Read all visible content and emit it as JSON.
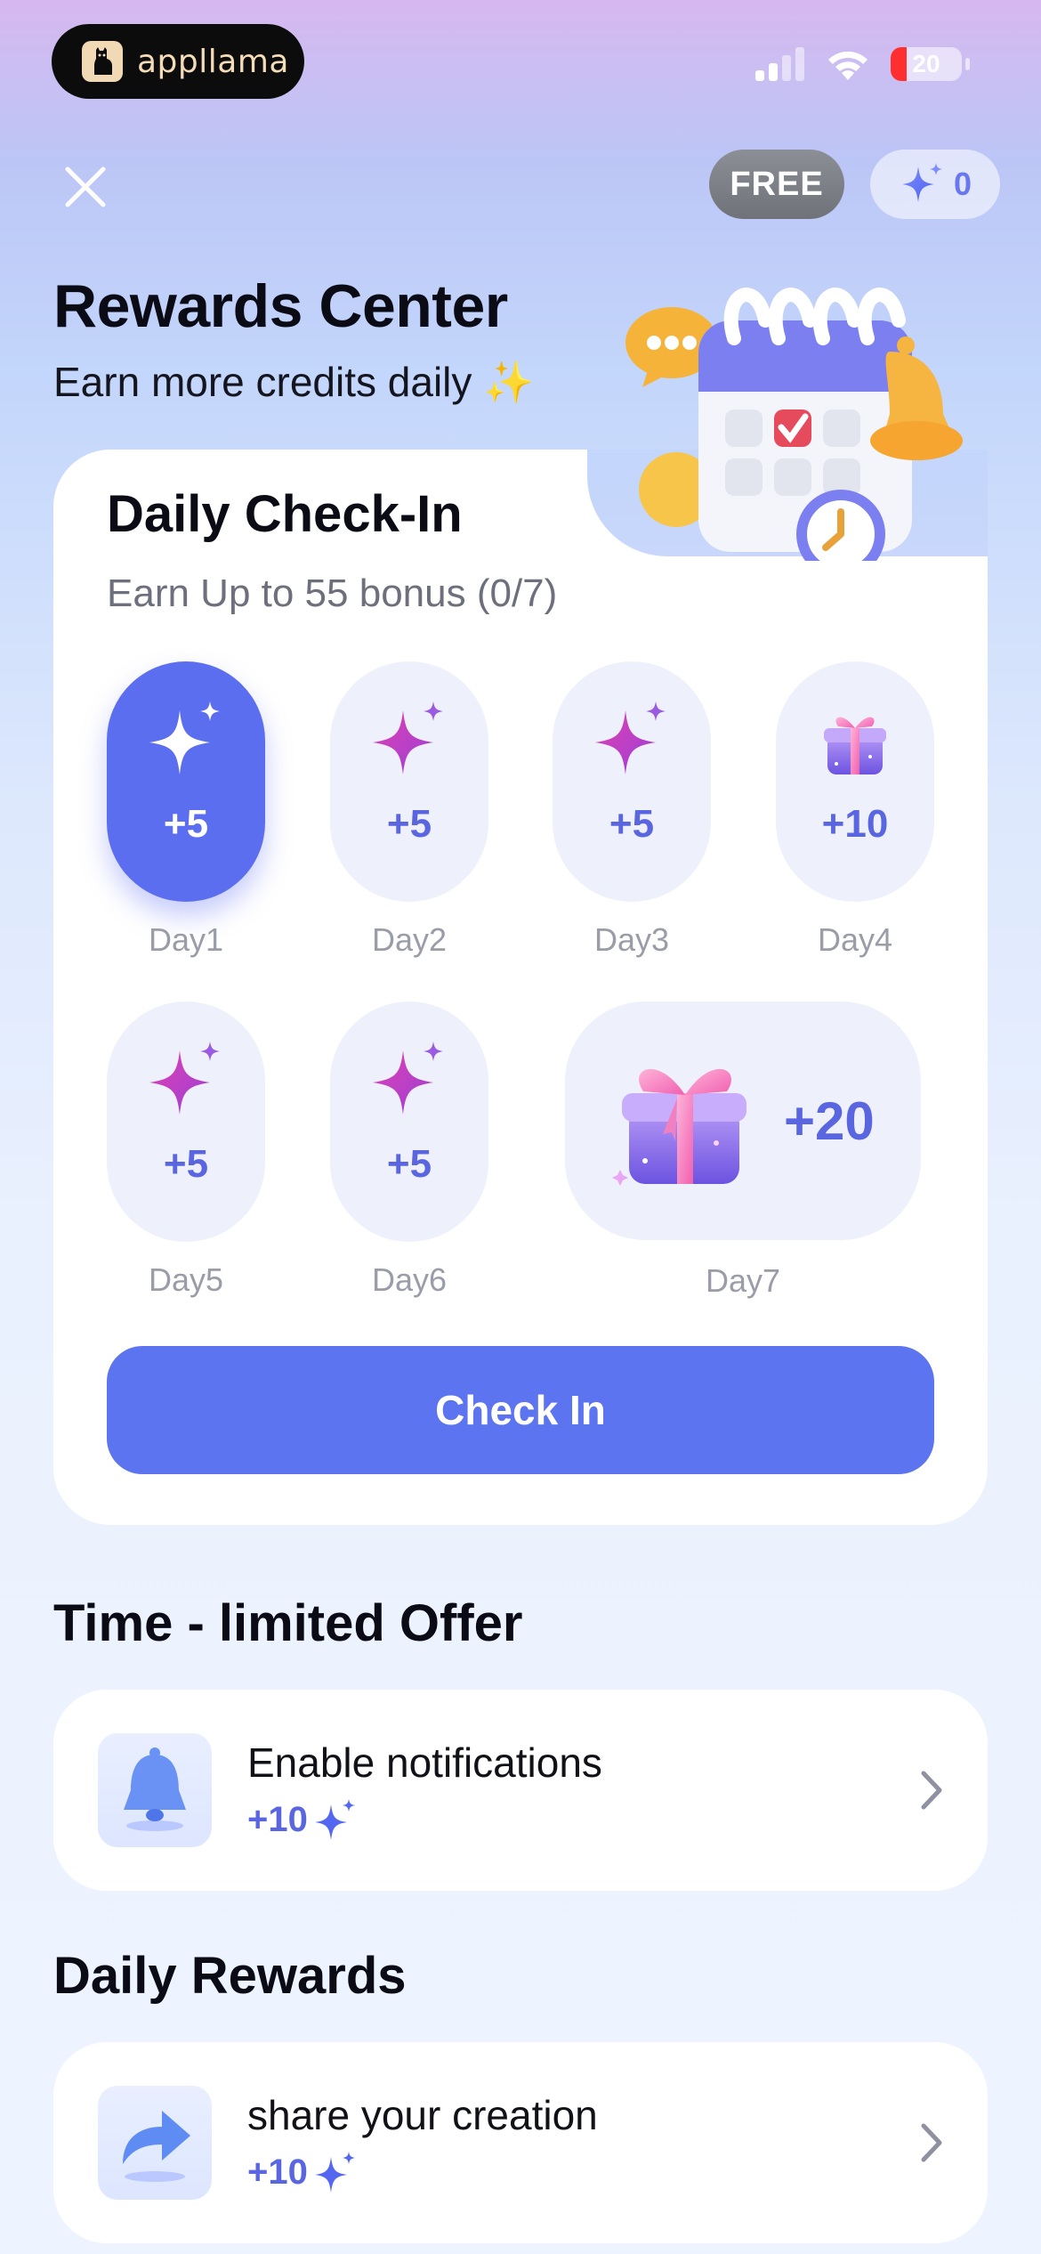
{
  "status_bar": {
    "brand_name": "appllama",
    "battery_level": "20"
  },
  "header": {
    "plan_badge": "FREE",
    "credits": "0",
    "title": "Rewards Center",
    "subtitle": "Earn more credits daily ✨"
  },
  "checkin": {
    "title": "Daily Check-In",
    "subtitle": "Earn Up to 55 bonus (0/7)",
    "button_label": "Check In",
    "days": [
      {
        "label": "Day1",
        "amount": "+5",
        "icon": "sparkle-icon",
        "active": true
      },
      {
        "label": "Day2",
        "amount": "+5",
        "icon": "sparkle-icon",
        "active": false
      },
      {
        "label": "Day3",
        "amount": "+5",
        "icon": "sparkle-icon",
        "active": false
      },
      {
        "label": "Day4",
        "amount": "+10",
        "icon": "gift-icon",
        "active": false
      },
      {
        "label": "Day5",
        "amount": "+5",
        "icon": "sparkle-icon",
        "active": false
      },
      {
        "label": "Day6",
        "amount": "+5",
        "icon": "sparkle-icon",
        "active": false
      },
      {
        "label": "Day7",
        "amount": "+20",
        "icon": "gift-icon",
        "active": false
      }
    ]
  },
  "limited_offer": {
    "title": "Time - limited Offer",
    "tasks": [
      {
        "name": "Enable notifications",
        "reward": "+10",
        "icon": "bell-icon"
      }
    ]
  },
  "daily_rewards": {
    "title": "Daily Rewards",
    "tasks": [
      {
        "name": "share your creation",
        "reward": "+10",
        "icon": "share-arrow-icon"
      }
    ]
  },
  "colors": {
    "accent": "#5d74f1",
    "accent_text": "#5a66e0",
    "sparkle_pink": "#c93fc2"
  }
}
